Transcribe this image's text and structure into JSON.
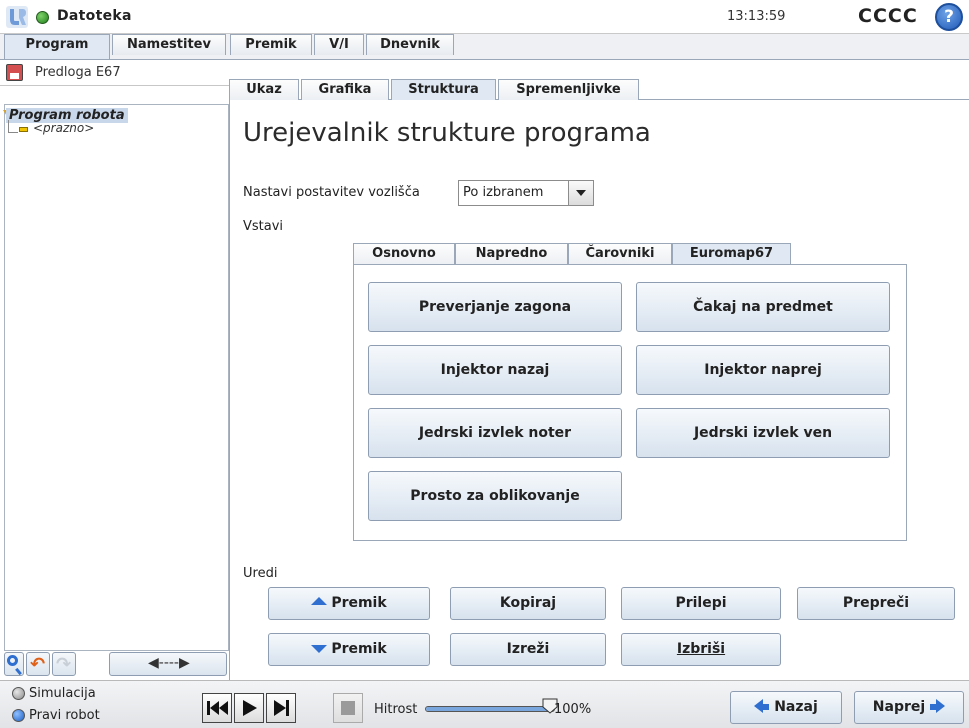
{
  "header": {
    "app_title": "Datoteka",
    "clock": "13:13:59",
    "robot_name": "CCCC",
    "help_glyph": "?",
    "status_color": "#3cae2c"
  },
  "main_tabs": [
    {
      "label": "Program",
      "active": true
    },
    {
      "label": "Namestitev",
      "active": false
    },
    {
      "label": "Premik",
      "active": false
    },
    {
      "label": "V/I",
      "active": false
    },
    {
      "label": "Dnevnik",
      "active": false
    }
  ],
  "left_panel": {
    "template_name": "Predloga E67",
    "tree": {
      "root": "Program robota",
      "child": "<prazno>"
    }
  },
  "sub_tabs": [
    {
      "label": "Ukaz",
      "active": false
    },
    {
      "label": "Grafika",
      "active": false
    },
    {
      "label": "Struktura",
      "active": true
    },
    {
      "label": "Spremenljivke",
      "active": false
    }
  ],
  "structure_editor": {
    "title": "Urejevalnik strukture programa",
    "layout_label": "Nastavi postavitev vozlišča",
    "layout_value": "Po izbranem",
    "insert_label": "Vstavi",
    "insert_tabs": [
      {
        "label": "Osnovno",
        "active": false
      },
      {
        "label": "Napredno",
        "active": false
      },
      {
        "label": "Čarovniki",
        "active": false
      },
      {
        "label": "Euromap67",
        "active": true
      }
    ],
    "insert_buttons": [
      "Preverjanje zagona",
      "Čakaj na predmet",
      "Injektor nazaj",
      "Injektor naprej",
      "Jedrski izvlek noter",
      "Jedrski izvlek ven",
      "Prosto za oblikovanje"
    ],
    "edit_label": "Uredi",
    "edit_buttons": {
      "move_up": "Premik",
      "copy": "Kopiraj",
      "paste": "Prilepi",
      "suppress": "Prepreči",
      "move_down": "Premik",
      "cut": "Izreži",
      "delete": "Izbriši"
    }
  },
  "footer": {
    "mode_simulation": "Simulacija",
    "mode_real": "Pravi robot",
    "selected_mode": "Pravi robot",
    "speed_label": "Hitrost",
    "speed_value": "100%",
    "speed_fraction": 1.0,
    "back_label": "Nazaj",
    "next_label": "Naprej"
  }
}
